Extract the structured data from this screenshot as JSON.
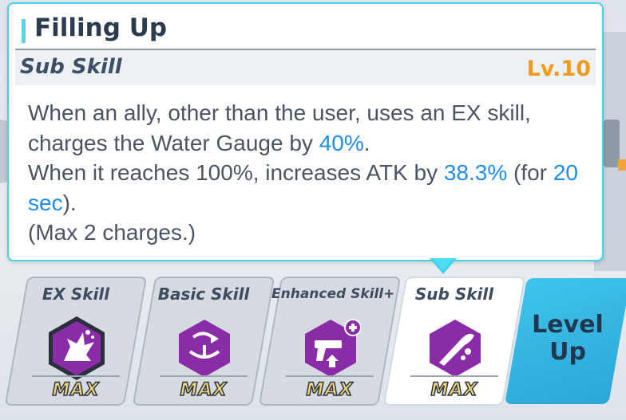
{
  "tooltip": {
    "title": "Filling Up",
    "type_label": "Sub Skill",
    "level": "Lv.10",
    "desc": {
      "line1": "When an ally, other than the user, uses an EX skill,",
      "line2_pre": "charges the Water Gauge by ",
      "line2_hl": "40%",
      "line2_post": ".",
      "line3_pre": "When it reaches 100%, increases ATK by ",
      "line3_hl": "38.3%",
      "line3_mid": " (for ",
      "line3_hl2": "20",
      "line4_hl": "sec",
      "line4_post": ").",
      "line5": "(Max 2 charges.)"
    }
  },
  "cards": [
    {
      "label": "EX Skill",
      "level": "MAX",
      "icon": "explosion-icon",
      "active": false
    },
    {
      "label": "Basic Skill",
      "level": "MAX",
      "icon": "target-arrow-icon",
      "active": false
    },
    {
      "label": "Enhanced Skill+",
      "level": "MAX",
      "icon": "pistol-upgrade-icon",
      "active": false
    },
    {
      "label": "Sub Skill",
      "level": "MAX",
      "icon": "water-splash-icon",
      "active": true
    }
  ],
  "level_up": {
    "line1": "Level",
    "line2": "Up"
  },
  "colors": {
    "accent": "#3fd3ec",
    "highlight": "#1e8df0",
    "level": "#f29a1e",
    "icon_purple": "#8a2ba8"
  }
}
